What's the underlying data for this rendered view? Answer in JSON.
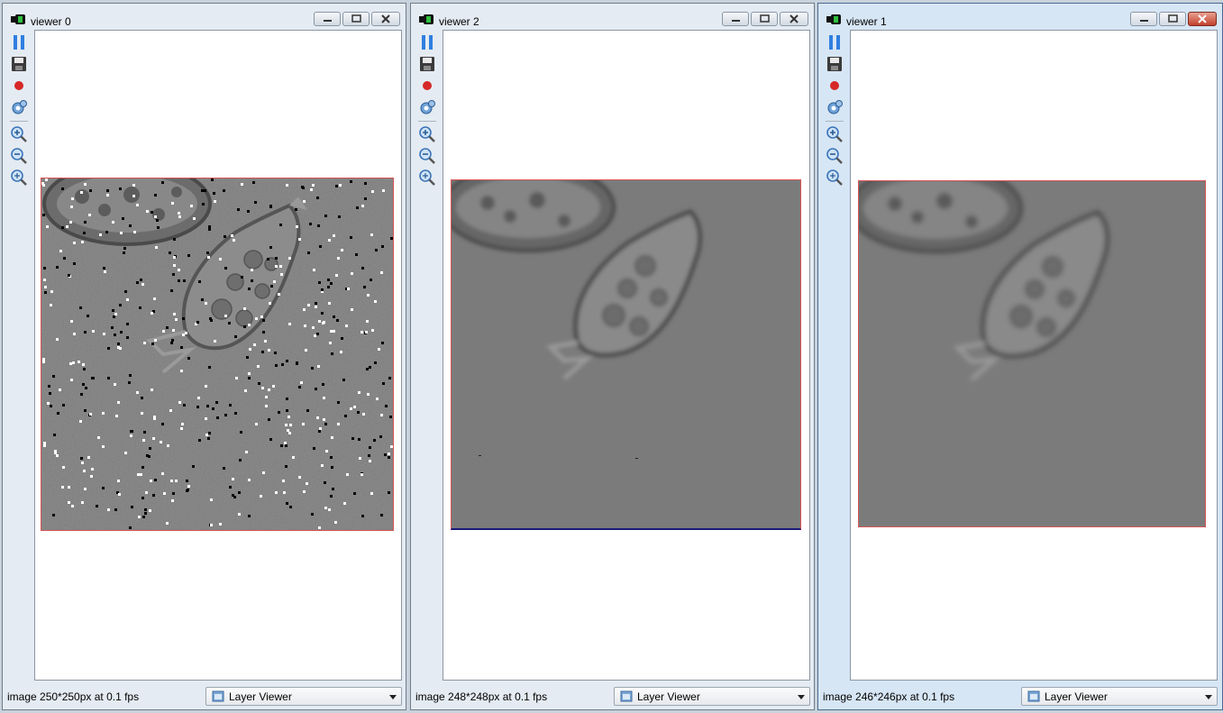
{
  "windows": [
    {
      "title": "viewer 0",
      "status": "image 250*250px at 0.1 fps",
      "dropdown": "Layer Viewer"
    },
    {
      "title": "viewer 2",
      "status": "image 248*248px at 0.1 fps",
      "dropdown": "Layer Viewer"
    },
    {
      "title": "viewer 1",
      "status": "image 246*246px at 0.1 fps",
      "dropdown": "Layer Viewer"
    }
  ],
  "toolbar_icons": [
    "pause-icon",
    "save-icon",
    "record-icon",
    "settings-icon",
    "zoom-in-icon",
    "zoom-out-icon",
    "zoom-fit-icon"
  ],
  "colors": {
    "record": "#d62828",
    "frame_border": "#d65454",
    "close_active": "#c3412c"
  }
}
